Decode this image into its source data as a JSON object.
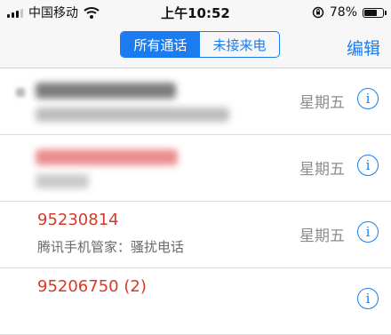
{
  "status_bar": {
    "carrier": "中国移动",
    "time": "上午10:52",
    "battery_percent": "78%",
    "battery_level": 0.78,
    "icons": [
      "signal-icon",
      "wifi-icon",
      "orientation-lock-icon",
      "battery-icon"
    ]
  },
  "nav": {
    "segments": [
      "所有通话",
      "未接来电"
    ],
    "selected_segment": "所有通话",
    "edit_label": "编辑"
  },
  "colors": {
    "accent": "#1a7cf0",
    "missed_call": "#d43a2a",
    "secondary_text": "#8c8c8c"
  },
  "calls": [
    {
      "name": "",
      "detail": "",
      "day": "星期五",
      "redacted": true
    },
    {
      "name": "",
      "detail": "",
      "day": "星期五",
      "redacted": true
    },
    {
      "name": "95230814",
      "detail": "腾讯手机管家：骚扰电话",
      "day": "星期五",
      "redacted": false
    },
    {
      "name": "95206750 (2)",
      "detail": "",
      "day": "",
      "redacted": false
    }
  ]
}
